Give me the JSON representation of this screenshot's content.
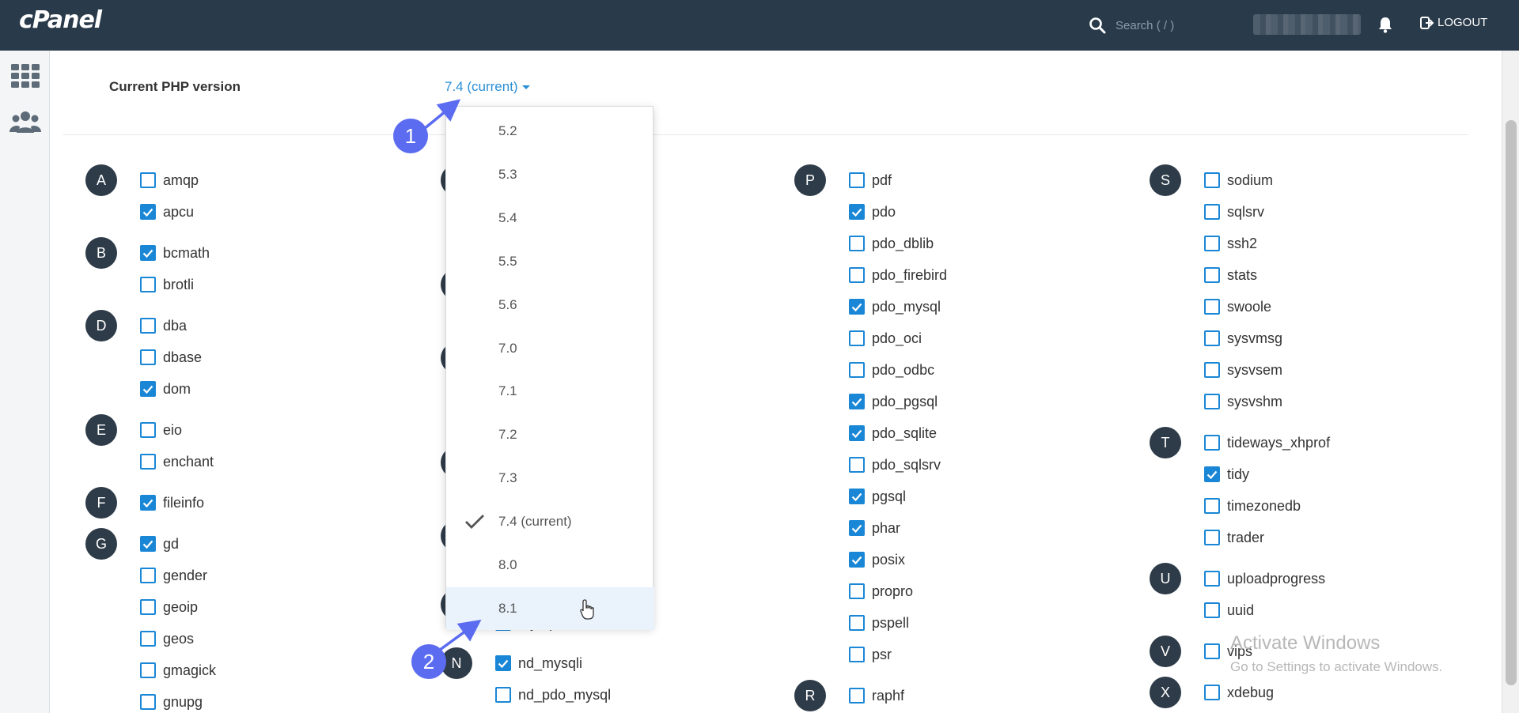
{
  "header": {
    "logo": "cPanel",
    "search_placeholder": "Search ( / )",
    "logout_label": "LOGOUT"
  },
  "php": {
    "label": "Current PHP version",
    "current": "7.4 (current)"
  },
  "dropdown": {
    "options": [
      "5.2",
      "5.3",
      "5.4",
      "5.5",
      "5.6",
      "7.0",
      "7.1",
      "7.2",
      "7.3",
      "7.4 (current)",
      "8.0",
      "8.1"
    ],
    "selected": "7.4 (current)",
    "hovered": "8.1"
  },
  "annotations": [
    "1",
    "2"
  ],
  "columns": [
    {
      "groups": [
        {
          "letter": "A",
          "items": [
            {
              "name": "amqp",
              "checked": false
            },
            {
              "name": "apcu",
              "checked": true
            }
          ]
        },
        {
          "letter": "B",
          "items": [
            {
              "name": "bcmath",
              "checked": true
            },
            {
              "name": "brotli",
              "checked": false
            }
          ]
        },
        {
          "letter": "D",
          "items": [
            {
              "name": "dba",
              "checked": false
            },
            {
              "name": "dbase",
              "checked": false
            },
            {
              "name": "dom",
              "checked": true
            }
          ]
        },
        {
          "letter": "E",
          "items": [
            {
              "name": "eio",
              "checked": false
            },
            {
              "name": "enchant",
              "checked": false
            }
          ]
        },
        {
          "letter": "F",
          "items": [
            {
              "name": "fileinfo",
              "checked": true
            }
          ]
        },
        {
          "letter": "G",
          "items": [
            {
              "name": "gd",
              "checked": true
            },
            {
              "name": "gender",
              "checked": false
            },
            {
              "name": "geoip",
              "checked": false
            },
            {
              "name": "geos",
              "checked": false
            },
            {
              "name": "gmagick",
              "checked": false
            },
            {
              "name": "gnupg",
              "checked": false
            }
          ]
        }
      ]
    },
    {
      "groups": [
        {
          "letter": "N",
          "items": [
            {
              "name": "nd_mysqli",
              "checked": true
            },
            {
              "name": "nd_pdo_mysql",
              "checked": false
            }
          ]
        }
      ]
    },
    {
      "groups": [
        {
          "letter": "P",
          "items": [
            {
              "name": "pdf",
              "checked": false
            },
            {
              "name": "pdo",
              "checked": true
            },
            {
              "name": "pdo_dblib",
              "checked": false
            },
            {
              "name": "pdo_firebird",
              "checked": false
            },
            {
              "name": "pdo_mysql",
              "checked": true
            },
            {
              "name": "pdo_oci",
              "checked": false
            },
            {
              "name": "pdo_odbc",
              "checked": false
            },
            {
              "name": "pdo_pgsql",
              "checked": true
            },
            {
              "name": "pdo_sqlite",
              "checked": true
            },
            {
              "name": "pdo_sqlsrv",
              "checked": false
            },
            {
              "name": "pgsql",
              "checked": true
            },
            {
              "name": "phar",
              "checked": true
            },
            {
              "name": "posix",
              "checked": true
            },
            {
              "name": "propro",
              "checked": false
            },
            {
              "name": "pspell",
              "checked": false
            },
            {
              "name": "psr",
              "checked": false
            }
          ]
        },
        {
          "letter": "R",
          "items": [
            {
              "name": "raphf",
              "checked": false
            }
          ]
        }
      ]
    },
    {
      "groups": [
        {
          "letter": "S",
          "items": [
            {
              "name": "sodium",
              "checked": false
            },
            {
              "name": "sqlsrv",
              "checked": false
            },
            {
              "name": "ssh2",
              "checked": false
            },
            {
              "name": "stats",
              "checked": false
            },
            {
              "name": "swoole",
              "checked": false
            },
            {
              "name": "sysvmsg",
              "checked": false
            },
            {
              "name": "sysvsem",
              "checked": false
            },
            {
              "name": "sysvshm",
              "checked": false
            }
          ]
        },
        {
          "letter": "T",
          "items": [
            {
              "name": "tideways_xhprof",
              "checked": false
            },
            {
              "name": "tidy",
              "checked": true
            },
            {
              "name": "timezonedb",
              "checked": false
            },
            {
              "name": "trader",
              "checked": false
            }
          ]
        },
        {
          "letter": "U",
          "items": [
            {
              "name": "uploadprogress",
              "checked": false
            },
            {
              "name": "uuid",
              "checked": false
            }
          ]
        },
        {
          "letter": "V",
          "items": [
            {
              "name": "vips",
              "checked": false
            }
          ]
        },
        {
          "letter": "X",
          "items": [
            {
              "name": "xdebug",
              "checked": false
            }
          ]
        }
      ]
    }
  ],
  "hidden_column_letters": [
    "",
    "",
    "",
    "",
    "",
    ""
  ],
  "partial_item": "mysqli",
  "watermark": {
    "title": "Activate Windows",
    "subtitle": "Go to Settings to activate Windows."
  },
  "colors": {
    "header_bg": "#293a4a",
    "accent": "#1a87d6",
    "letter_badge": "#2e3b48",
    "annotation": "#5b6cf0"
  }
}
